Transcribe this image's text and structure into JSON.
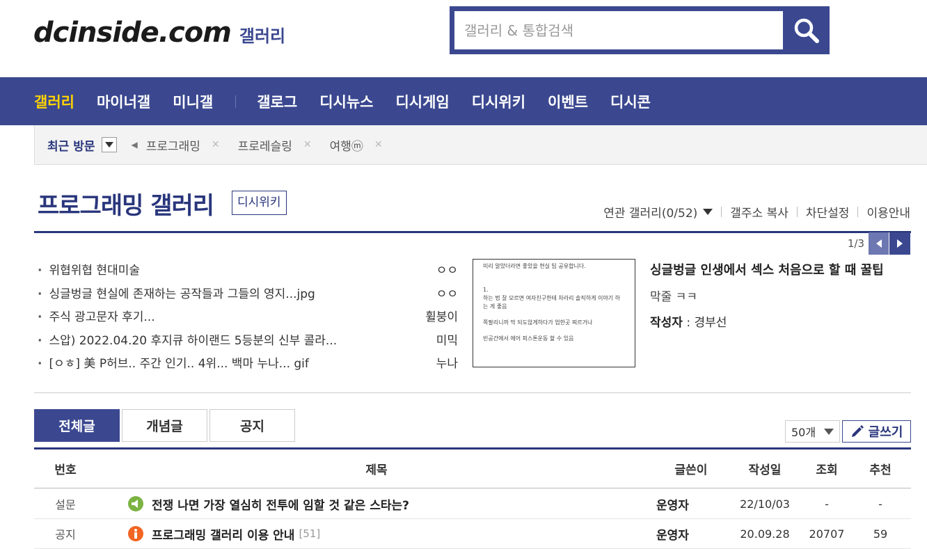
{
  "header": {
    "logo_main": "dcinside.com",
    "logo_sub": "갤러리",
    "search_placeholder": "갤러리 & 통합검색"
  },
  "nav": {
    "items": [
      "갤러리",
      "마이너갤",
      "미니갤",
      "갤로그",
      "디시뉴스",
      "디시게임",
      "디시위키",
      "이벤트",
      "디시콘"
    ]
  },
  "recent": {
    "title": "최근 방문",
    "items": [
      "프로그래밍",
      "프로레슬링",
      "여행ⓜ"
    ]
  },
  "gallery": {
    "title": "프로그래밍 갤러리",
    "wiki_label": "디시위키",
    "tools": [
      "연관 갤러리(0/52)",
      "갤주소 복사",
      "차단설정",
      "이용안내"
    ]
  },
  "featured": {
    "pager": "1/3",
    "list": [
      {
        "title": "위협위협 현대미술",
        "author": "ㅇㅇ"
      },
      {
        "title": "싱글벙글 현실에 존재하는 공작들과 그들의 영지...jpg",
        "author": "ㅇㅇ"
      },
      {
        "title": "주식 광고문자 후기...",
        "author": "휠붕이"
      },
      {
        "title": "스압) 2022.04.20 후지큐 하이랜드 5등분의 신부 콜라...",
        "author": "미믹"
      },
      {
        "title": "[ㅇㅎ] 美 P허브.. 주간 인기.. 4위... 백마 누나... gif",
        "author": "누나"
      }
    ],
    "thumb_lines": [
      "미리 알았더라면 좋았을 현실 팁 공유합니다.",
      "1.",
      "하는 법 잘 모르면 여자친구한테 차라리 솔직하게 이야기 하는 게 좋음",
      "쪽팔리니까 막 되도않게하다가 엄한곳 찌르거나",
      "빈공간에서 에어 피스톤운동 할 수 있음"
    ],
    "detail_title": "싱글벙글 인생에서 섹스 처음으로 할 때 꿀팁",
    "detail_sub": "막줄 ㅋㅋ",
    "detail_author_label": "작성자",
    "detail_author": "경부선"
  },
  "tabs": [
    "전체글",
    "개념글",
    "공지"
  ],
  "list_controls": {
    "count": "50개",
    "write": "글쓰기"
  },
  "table": {
    "headers": [
      "번호",
      "제목",
      "글쓴이",
      "작성일",
      "조회",
      "추천"
    ],
    "rows": [
      {
        "num": "설문",
        "icon": "megaphone-icon",
        "icon_color": "#7cb342",
        "title": "전쟁 나면 가장 열심히 전투에 임할 것 같은 스타는?",
        "reply": "",
        "writer": "운영자",
        "date": "22/10/03",
        "views": "-",
        "rec": "-"
      },
      {
        "num": "공지",
        "icon": "info-icon",
        "icon_color": "#f26522",
        "title": "프로그래밍 갤러리 이용 안내",
        "reply": "[51]",
        "writer": "운영자",
        "date": "20.09.28",
        "views": "20707",
        "rec": "59"
      }
    ]
  },
  "colors": {
    "brand": "#3b4890",
    "brand_dark": "#29367c",
    "nav_active": "#ffd400"
  }
}
